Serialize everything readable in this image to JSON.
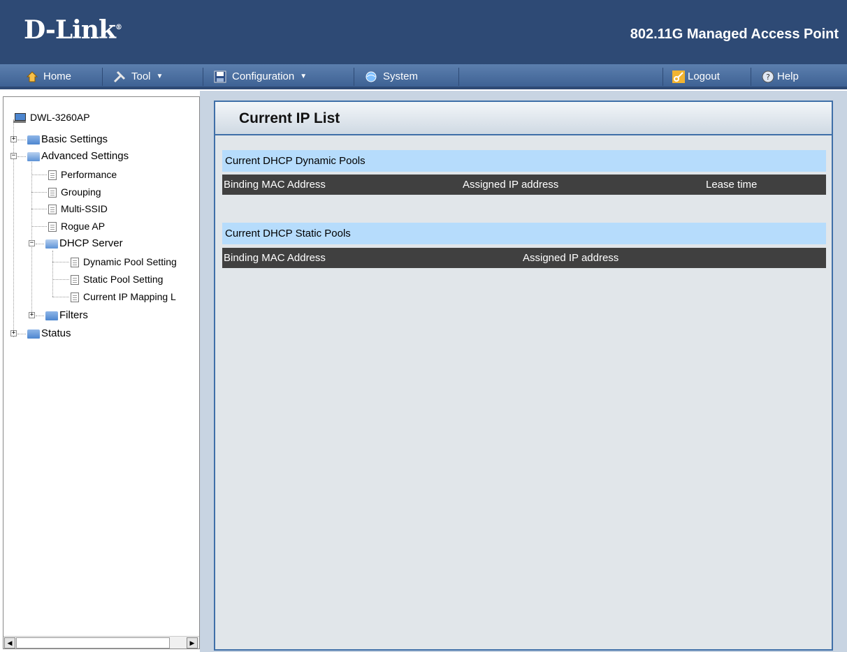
{
  "header": {
    "logo": "D-Link",
    "product": "802.11G Managed Access Point"
  },
  "menubar": {
    "home": "Home",
    "tool": "Tool",
    "configuration": "Configuration",
    "system": "System",
    "logout": "Logout",
    "help": "Help"
  },
  "tree": {
    "root": "DWL-3260AP",
    "basic": "Basic Settings",
    "advanced": "Advanced Settings",
    "performance": "Performance",
    "grouping": "Grouping",
    "multissid": "Multi-SSID",
    "rogueap": "Rogue AP",
    "dhcp": "DHCP Server",
    "dynamic": "Dynamic Pool Setting",
    "static": "Static Pool Setting",
    "current": "Current IP Mapping L",
    "filters": "Filters",
    "status": "Status"
  },
  "main": {
    "title": "Current IP List",
    "dynamic_title": "Current DHCP Dynamic Pools",
    "dynamic_cols": [
      "Binding MAC Address",
      "Assigned IP address",
      "Lease time"
    ],
    "static_title": "Current DHCP Static Pools",
    "static_cols": [
      "Binding MAC Address",
      "Assigned IP address"
    ]
  }
}
